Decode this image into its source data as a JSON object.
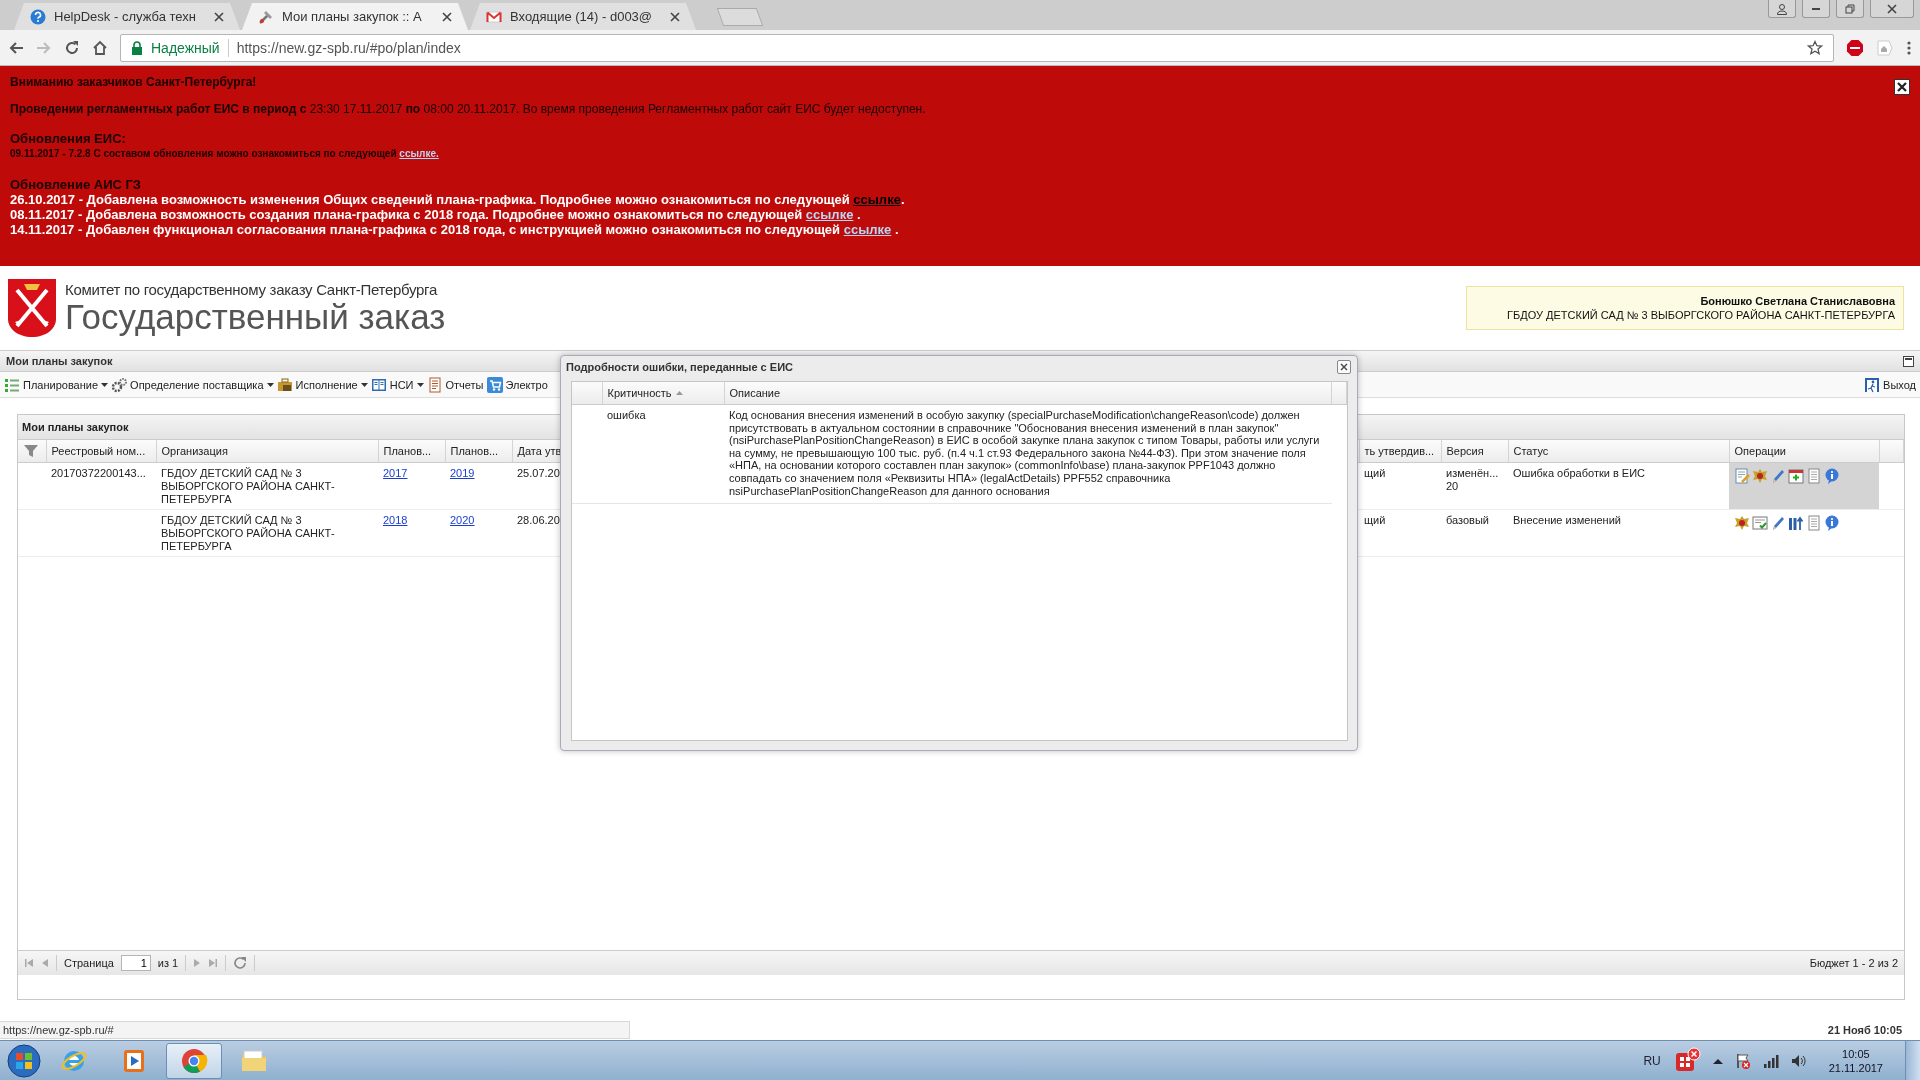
{
  "browser": {
    "tabs": [
      {
        "title": "HelpDesk - служба техн",
        "kind": "help",
        "selected": false
      },
      {
        "title": "Мои планы закупок :: А",
        "kind": "tools",
        "selected": true
      },
      {
        "title": "Входящие (14) - d003@",
        "kind": "mail",
        "selected": false
      }
    ],
    "security_label": "Надежный",
    "url": "https://new.gz-spb.ru/#po/plan/index"
  },
  "banner": {
    "title": "Вниманию заказчиков Санкт-Петербурга!",
    "maintenance": "**Проведении регламентных работ ЕИС в период с** 23:30 17.11.2017 **по** 08:00 20.11.2017. Во время проведения Регламентных работ сайт ЕИС будет недоступен.",
    "eis_heading": "Обновления ЕИС:",
    "eis_updates": [
      {
        "text": "09.11.2017 - 7.2.8 С составом обновления можно ознакомиться по следующей",
        "link": "ссылке.",
        "visited": false
      }
    ],
    "ais_heading": "Обновление АИС ГЗ",
    "ais_updates": [
      {
        "text": "26.10.2017 - Добавлена возможность изменения Общих сведений плана-графика. Подробнее можно ознакомиться по следующей",
        "link": "ссылке",
        "after": ".",
        "visited": true
      },
      {
        "text": "08.11.2017 - Добавлена возможность создания плана-графика с 2018 года. Подробнее можно ознакомиться по следующей",
        "link": "ссылке",
        "after": " .",
        "visited": false
      },
      {
        "text": "14.11.2017 - Добавлен функционал согласования плана-графика с 2018 года, с инструкцией можно ознакомиться по следующей",
        "link": "ссылке",
        "after": " .",
        "visited": false
      }
    ]
  },
  "header": {
    "committee": "Комитет по государственному заказу Санкт-Петербурга",
    "title": "Государственный заказ",
    "user": {
      "name": "Бонюшко Светлана Станиславовна",
      "organization": "ГБДОУ ДЕТСКИЙ САД № 3 ВЫБОРГСКОГО РАЙОНА САНКТ-ПЕТЕРБУРГА"
    }
  },
  "panel": {
    "title": "Мои планы закупок",
    "toolbar": [
      {
        "label": "Планирование",
        "kind": "list",
        "dropdown": true
      },
      {
        "label": "Определение поставщика",
        "kind": "gears",
        "dropdown": true
      },
      {
        "label": "Исполнение",
        "kind": "briefcase",
        "dropdown": true
      },
      {
        "label": "НСИ",
        "kind": "book",
        "dropdown": true
      },
      {
        "label": "Отчеты",
        "kind": "report",
        "dropdown": false
      },
      {
        "label": "Электро",
        "kind": "cart",
        "dropdown": false
      }
    ],
    "exit": "Выход",
    "grid": {
      "title": "Мои планы закупок",
      "columns": [
        "Реестровый ном...",
        "Организация",
        "Планов...",
        "Планов...",
        "Дата утв",
        "ть утвердив...",
        "Версия",
        "Статус",
        "Операции"
      ],
      "rows": [
        {
          "registry": "20170372200143...",
          "organization": "ГБДОУ ДЕТСКИЙ САД № 3 ВЫБОРГСКОГО РАЙОНА САНКТ-ПЕТЕРБУРГА",
          "plan_from": "2017",
          "plan_to": "2019",
          "date": "25.07.20",
          "column_6": "щий",
          "version": "изменён... 20",
          "status": "Ошибка обработки в ЕИС",
          "hovered": true,
          "operations": [
            {
              "kind": "document-edit"
            },
            {
              "kind": "emblem"
            },
            {
              "kind": "pencil"
            },
            {
              "kind": "calendar"
            },
            {
              "kind": "document"
            },
            {
              "kind": "info"
            }
          ]
        },
        {
          "organization": "ГБДОУ ДЕТСКИЙ САД № 3 ВЫБОРГСКОГО РАЙОНА САНКТ-ПЕТЕРБУРГА",
          "plan_from": "2018",
          "plan_to": "2020",
          "date": "28.06.20",
          "column_6": "щий",
          "version": "базовый",
          "status": "Внесение изменений",
          "hovered": false,
          "operations": [
            {
              "kind": "emblem"
            },
            {
              "kind": "checklist"
            },
            {
              "kind": "pencil"
            },
            {
              "kind": "columns"
            },
            {
              "kind": "document"
            },
            {
              "kind": "info"
            }
          ]
        }
      ]
    },
    "pager": {
      "page_label": "Страница",
      "page": "1",
      "of": "из 1",
      "summary": "Бюджет 1 - 2 из 2"
    }
  },
  "dialog": {
    "title": "Подробности ошибки, переданные с ЕИС",
    "columns": [
      {
        "label": "Критичность",
        "sorted": true
      },
      {
        "label": "Описание",
        "sorted": false
      }
    ],
    "rows": [
      {
        "severity": "ошибка",
        "description": "Код основания внесения изменений в особую закупку (specialPurchaseModification\\changeReason\\code) должен присутствовать в актуальном состоянии в справочнике \"Обоснования внесения изменений в план закупок\" (nsiPurchasePlanPositionChangeReason) в ЕИС в особой закупке плана закупок с типом Товары, работы или услуги на сумму, не превышающую 100 тыс. руб. (п.4 ч.1 ст.93 Федерального закона №44-ФЗ). При этом значение поля «НПА, на основании которого составлен план закупок» (commonInfo\\base) плана-закупок PPF1043 должно совпадать со значением поля «Реквизиты НПА» (legalActDetails) PPF552 справочника nsiPurchasePlanPositionChangeReason для данного основания"
      }
    ]
  },
  "status_bar": {
    "url": "https://new.gz-spb.ru/#",
    "datetime": "21 Нояб 10:05"
  },
  "taskbar": {
    "apps": [
      {
        "kind": "ie",
        "selected": false
      },
      {
        "kind": "media",
        "selected": false
      },
      {
        "kind": "chrome",
        "selected": true
      },
      {
        "kind": "folder",
        "selected": false
      }
    ],
    "language": "RU",
    "time": "10:05",
    "date": "21.11.2017"
  }
}
